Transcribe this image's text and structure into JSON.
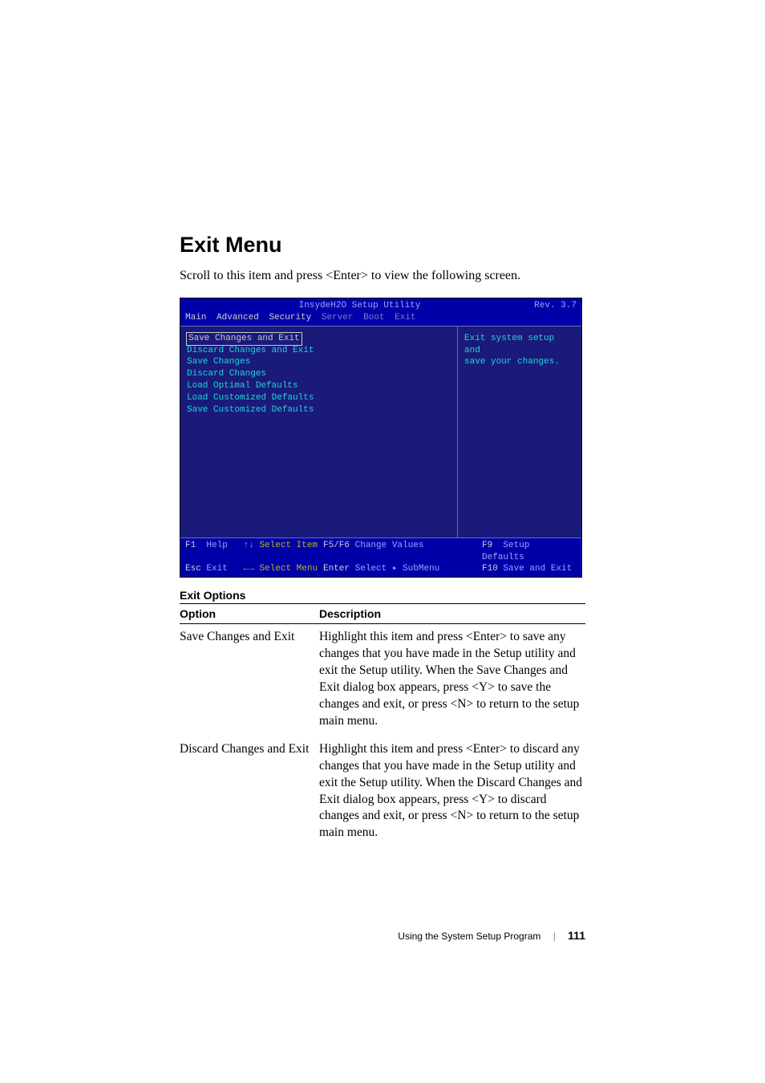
{
  "heading": "Exit Menu",
  "intro": "Scroll to this item and press <Enter> to view the following screen.",
  "bios": {
    "title": "InsydeH2O Setup Utility",
    "rev": "Rev. 3.7",
    "tabs": [
      "Main",
      "Advanced",
      "Security",
      "Server",
      "Boot",
      "Exit"
    ],
    "active_tab": "Exit",
    "menu": {
      "items": [
        "Save Changes and Exit",
        "Discard Changes and Exit",
        "Save Changes",
        "Discard Changes",
        "Load Optimal Defaults",
        "Load Customized Defaults",
        "Save Customized Defaults"
      ],
      "selected_index": 0
    },
    "help_line1": "Exit system setup and",
    "help_line2": "save your changes.",
    "footer": {
      "r1c1_k": "F1",
      "r1c1_t": "Help",
      "r1c1b_k": "↑↓",
      "r1c1b_t": "Select Item",
      "r1c2_k": "F5/F6",
      "r1c2_t": "Change Values",
      "r1c3_k": "F9",
      "r1c3_t": "Setup Defaults",
      "r2c1_k": "Esc",
      "r2c1_t": "Exit",
      "r2c1b_k": "←→",
      "r2c1b_t": "Select Menu",
      "r2c2_k": "Enter",
      "r2c2_t": "Select ▸ SubMenu",
      "r2c3_k": "F10",
      "r2c3_t": "Save and Exit"
    }
  },
  "table": {
    "caption": "Exit Options",
    "head_option": "Option",
    "head_desc": "Description",
    "rows": [
      {
        "option": "Save Changes and Exit",
        "desc": "Highlight this item and press <Enter> to save any changes that you have made in the Setup utility and exit the Setup utility. When the Save Changes and Exit dialog box appears, press <Y> to save the changes and exit, or press <N> to return to the setup main menu."
      },
      {
        "option": "Discard Changes and Exit",
        "desc": "Highlight this item and press <Enter> to discard any changes that you have made in the Setup utility and exit the Setup utility. When the Discard Changes and Exit dialog box appears, press <Y> to discard changes and exit, or press <N> to return to the setup main menu."
      }
    ]
  },
  "footer_text": "Using the System Setup Program",
  "page_number": "111"
}
